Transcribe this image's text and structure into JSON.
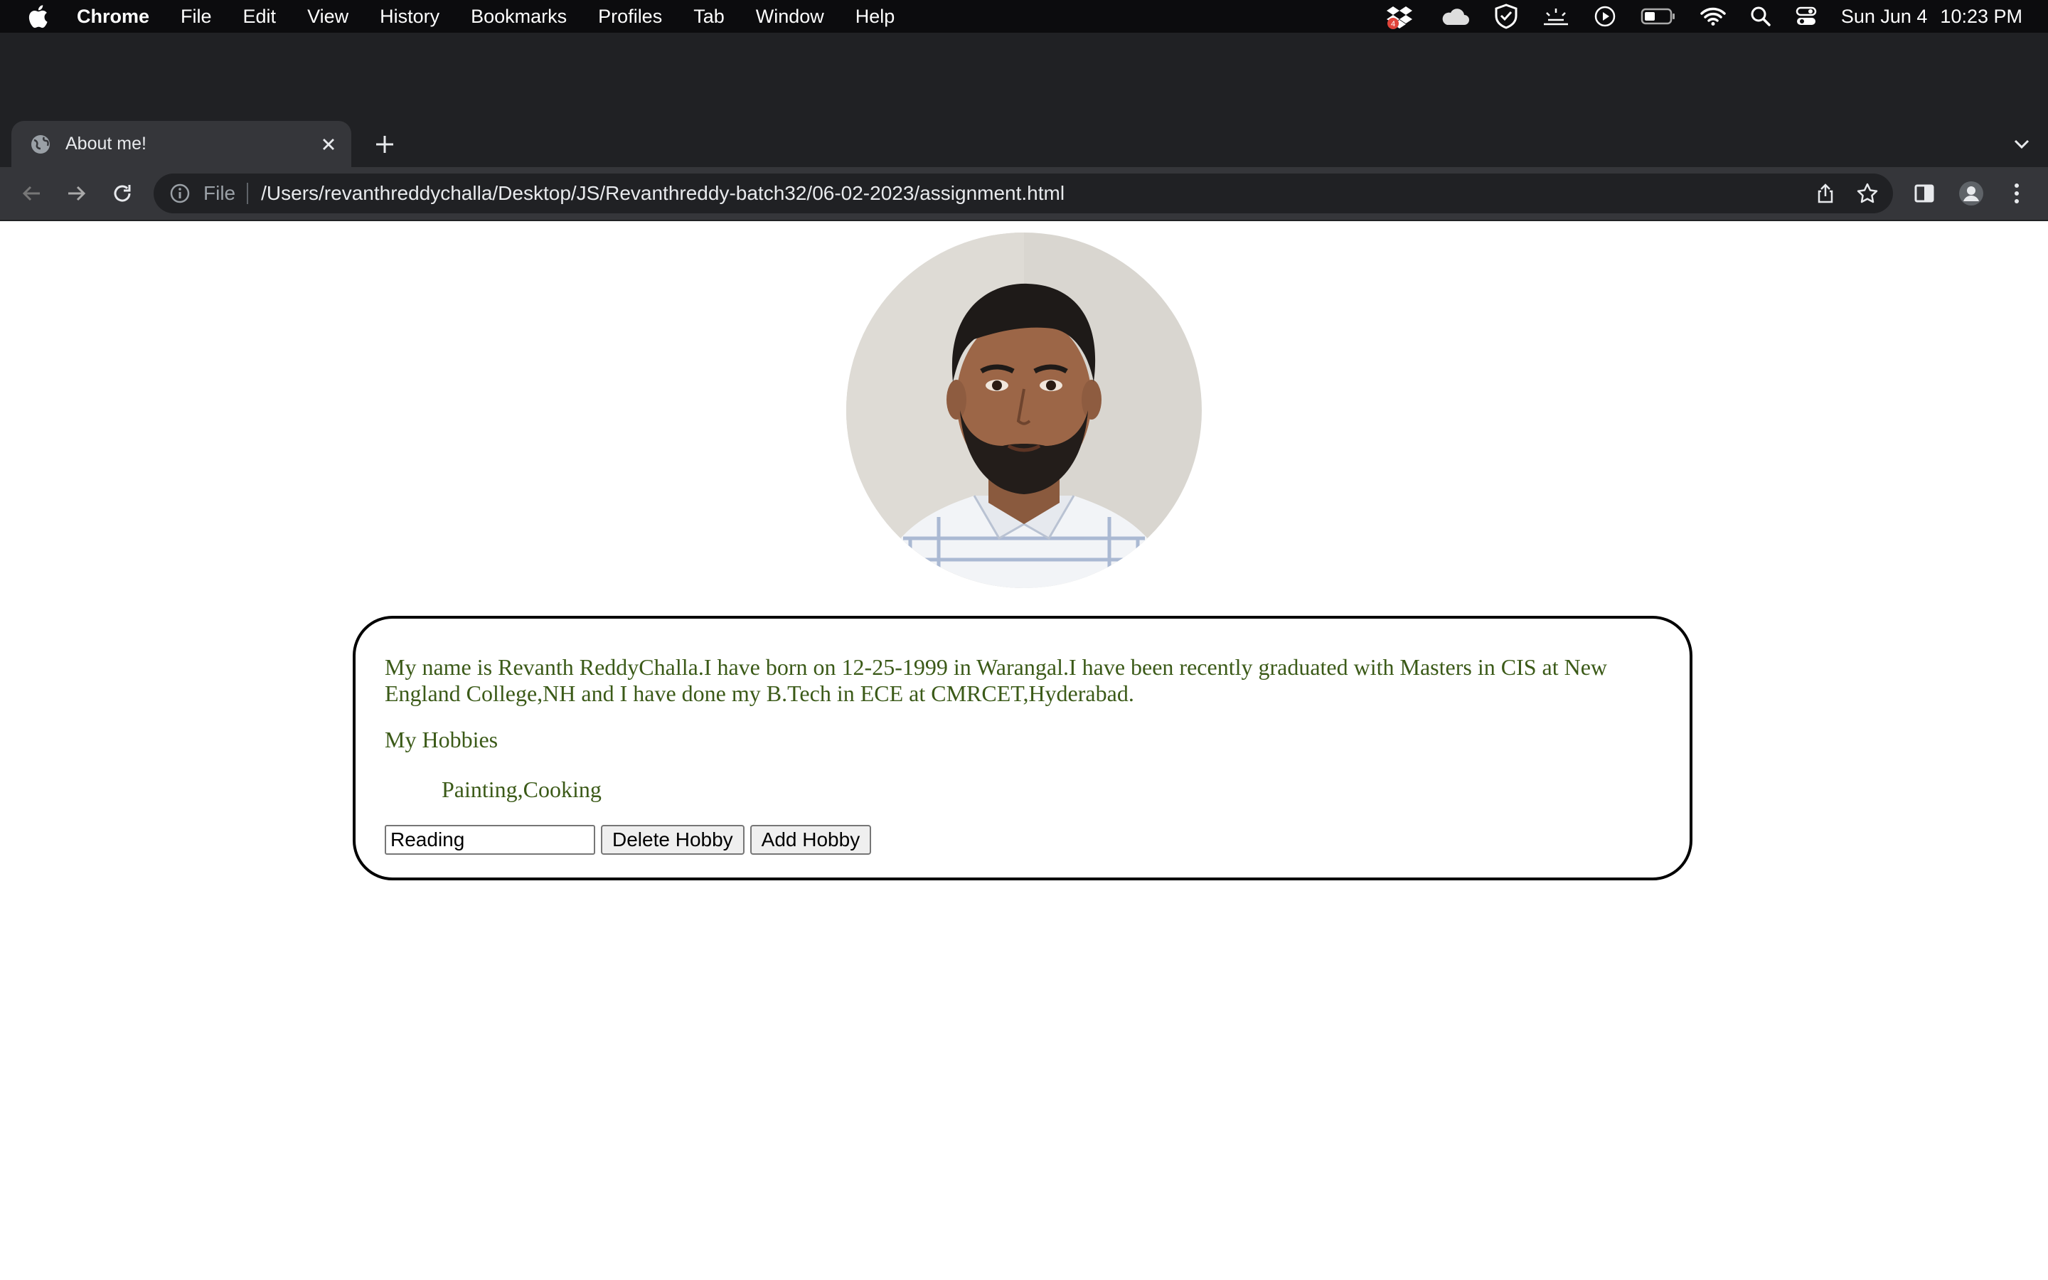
{
  "menubar": {
    "app_name": "Chrome",
    "items": [
      "File",
      "Edit",
      "View",
      "History",
      "Bookmarks",
      "Profiles",
      "Tab",
      "Window",
      "Help"
    ],
    "date": "Sun Jun 4",
    "time": "10:23 PM",
    "notification_badge": "4"
  },
  "browser": {
    "tab_title": "About me!",
    "url_scheme": "File",
    "url": "/Users/revanthreddychalla/Desktop/JS/Revanthreddy-batch32/06-02-2023/assignment.html"
  },
  "page": {
    "bio": "My name is Revanth ReddyChalla.I have born on 12-25-1999 in Warangal.I have been recently graduated with Masters in CIS at New England College,NH and I have done my B.Tech in ECE at CMRCET,Hyderabad.",
    "hobbies_title": "My Hobbies",
    "hobbies_list": "Painting,Cooking",
    "hobby_input_value": "Reading",
    "delete_button": "Delete Hobby",
    "add_button": "Add Hobby"
  },
  "colors": {
    "text_green": "#3b5a18",
    "menubar_bg": "#0c0c0e",
    "tabstrip_bg": "#202124",
    "toolbar_bg": "#35363a"
  }
}
